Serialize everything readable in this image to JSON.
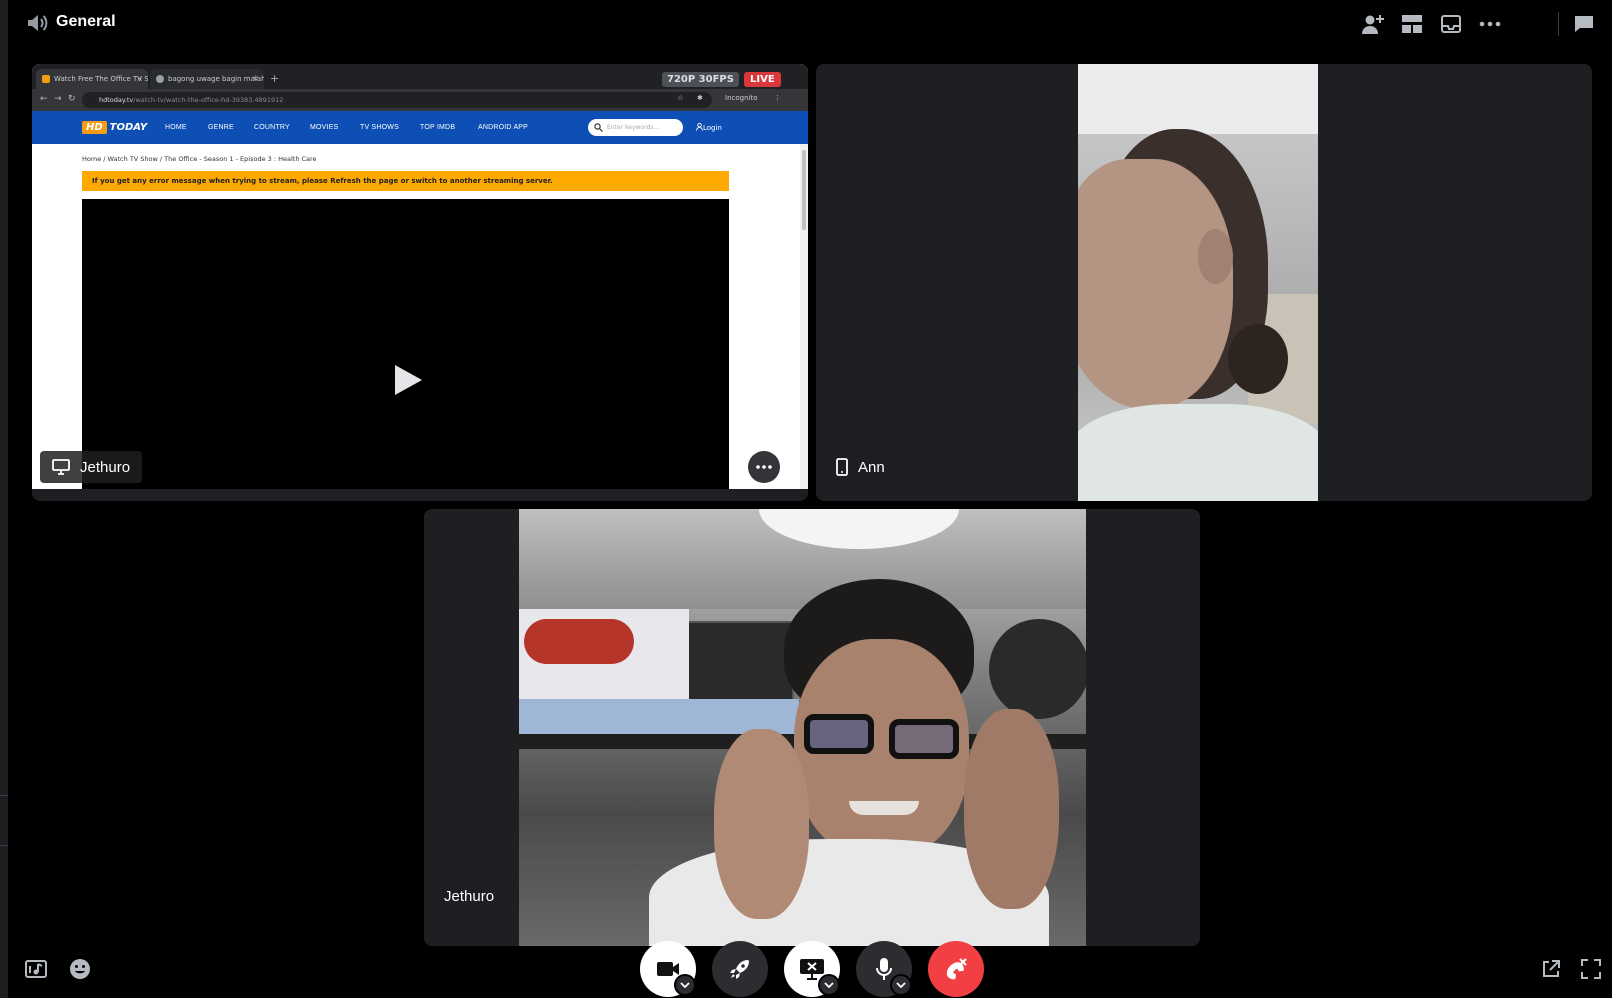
{
  "header": {
    "channel_icon": "speaker-icon",
    "channel_name": "General",
    "actions": [
      {
        "name": "add-user-icon"
      },
      {
        "name": "grid-layout-icon"
      },
      {
        "name": "inbox-icon"
      },
      {
        "name": "more-icon"
      },
      {
        "name": "chat-icon"
      }
    ]
  },
  "tiles": {
    "screen_share": {
      "user": "Jethuro",
      "type_icon": "monitor-icon",
      "stream_quality": "720P 30FPS",
      "live_label": "LIVE",
      "browser": {
        "tabs": [
          {
            "title": "Watch Free The Office TV Shows",
            "close": "×"
          },
          {
            "title": "bagong uwage bagin malaha",
            "close": "×"
          }
        ],
        "new_tab": "+",
        "url_host": "hdtoday.tv",
        "url_path": "/watch-tv/watch-the-office-hd-39383.4891912",
        "incognito_label": "Incognito",
        "site": {
          "logo_badge": "HD",
          "logo_text": "TODAY",
          "menu": [
            "HOME",
            "GENRE",
            "COUNTRY",
            "MOVIES",
            "TV SHOWS",
            "TOP IMDB",
            "ANDROID APP"
          ],
          "search_placeholder": "Enter keywords...",
          "login_label": "Login",
          "breadcrumb": "Home  /   Watch TV Show   /   The Office - Season 1 - Episode 3 : Health Care",
          "warning": "If you get any error message when trying to stream, please Refresh the page or switch to another streaming server."
        }
      }
    },
    "ann": {
      "user": "Ann",
      "type_icon": "phone-icon"
    },
    "jethuro_cam": {
      "user": "Jethuro"
    }
  },
  "controls": {
    "left": [
      "soundboard-icon",
      "emoji-icon"
    ],
    "center": [
      "camera-icon",
      "activity-rocket-icon",
      "stop-share-icon",
      "microphone-icon",
      "disconnect-icon"
    ],
    "right": [
      "popout-icon",
      "fullscreen-icon"
    ]
  },
  "colors": {
    "background": "#000000",
    "tile": "#1e1f22",
    "live": "#da373c",
    "disconnect": "#f23f43",
    "site_nav": "#0d4fb5",
    "warning": "#ffa800"
  }
}
